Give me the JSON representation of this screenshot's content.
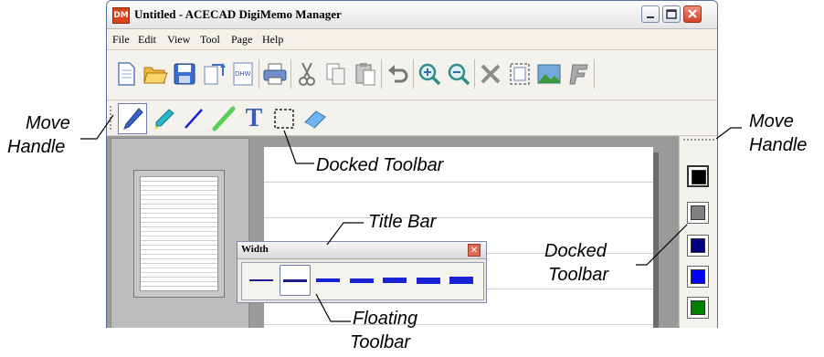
{
  "window": {
    "title": "Untitled - ACECAD DigiMemo Manager",
    "app_icon_text": "DM"
  },
  "menu": [
    "File",
    "Edit",
    "View",
    "Tool",
    "Page",
    "Help"
  ],
  "toolbar_main": [
    "new-file-icon",
    "open-folder-icon",
    "save-icon",
    "export-icon",
    "dhw-icon",
    "print-icon",
    "cut-icon",
    "copy-icon",
    "paste-icon",
    "undo-icon",
    "zoom-in-icon",
    "zoom-out-icon",
    "delete-icon",
    "select-page-icon",
    "image-icon",
    "font-icon"
  ],
  "toolbar_tools": [
    "pen-icon",
    "highlighter-icon",
    "line-icon",
    "marker-icon",
    "text-icon",
    "selection-icon",
    "eraser-icon"
  ],
  "tool_text_glyph": "T",
  "dhw_label": "DHW",
  "colors": {
    "swatches": [
      "#000000",
      "#808080",
      "#000080",
      "#0000ff",
      "#008000"
    ],
    "line_blue": "#1a22d6",
    "line_dark": "#1c1c8c"
  },
  "floating_toolbar": {
    "title": "Width",
    "close_glyph": "✕",
    "widths": [
      1,
      2,
      3,
      4,
      5,
      6,
      7
    ],
    "selected_index": 1
  },
  "annotations": {
    "move_handle_left": [
      "Move",
      "Handle"
    ],
    "move_handle_right": [
      "Move",
      "Handle"
    ],
    "docked_toolbar_top": "Docked Toolbar",
    "title_bar": "Title Bar",
    "docked_toolbar_right": [
      "Docked",
      "Toolbar"
    ],
    "floating_toolbar": [
      "Floating",
      "Toolbar"
    ]
  }
}
